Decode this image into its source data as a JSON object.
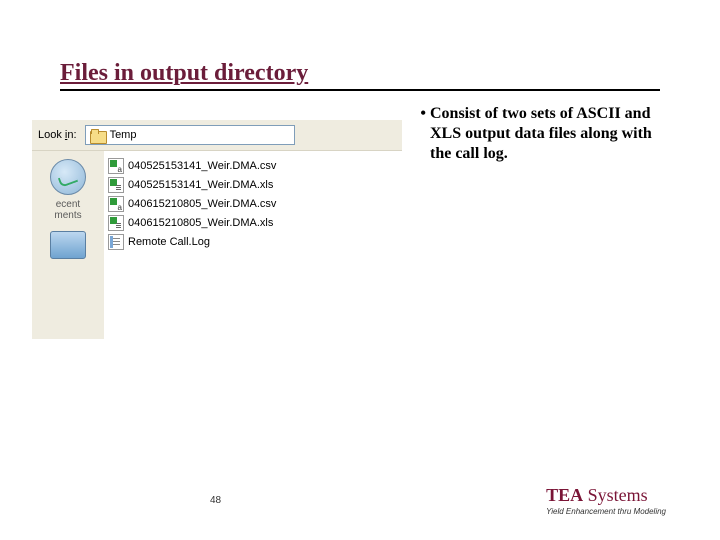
{
  "title": "Files in output directory",
  "bullet": "Consist of two sets of ASCII and XLS output data files along with the call log.",
  "dialog": {
    "lookin_label_pre": "Look ",
    "lookin_label_u": "i",
    "lookin_label_post": "n:",
    "folder_name": "Temp",
    "places": {
      "recent_line1": "ecent",
      "recent_line2": "ments"
    },
    "files": [
      {
        "icon": "csv",
        "name": "040525153141_Weir.DMA.csv"
      },
      {
        "icon": "xls",
        "name": "040525153141_Weir.DMA.xls"
      },
      {
        "icon": "csv",
        "name": "040615210805_Weir.DMA.csv"
      },
      {
        "icon": "xls",
        "name": "040615210805_Weir.DMA.xls"
      },
      {
        "icon": "log",
        "name": "Remote Call.Log"
      }
    ]
  },
  "page_number": "48",
  "brand_bold": "TEA",
  "brand_rest": " Systems",
  "tagline": "Yield Enhancement thru Modeling"
}
